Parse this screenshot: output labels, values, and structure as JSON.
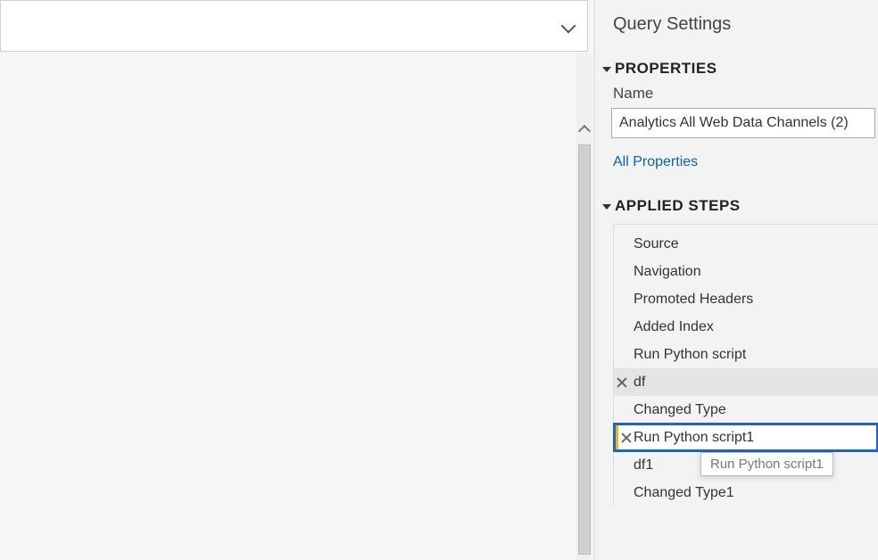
{
  "panel": {
    "title": "Query Settings",
    "properties": {
      "header": "PROPERTIES",
      "nameLabel": "Name",
      "nameValue": "Analytics All Web Data Channels (2)",
      "allPropsLink": "All Properties"
    },
    "appliedSteps": {
      "header": "APPLIED STEPS",
      "steps": [
        "Source",
        "Navigation",
        "Promoted Headers",
        "Added Index",
        "Run Python script",
        "df",
        "Changed Type",
        "Run Python script1",
        "df1",
        "Changed Type1"
      ]
    }
  },
  "tooltip": "Run Python script1"
}
